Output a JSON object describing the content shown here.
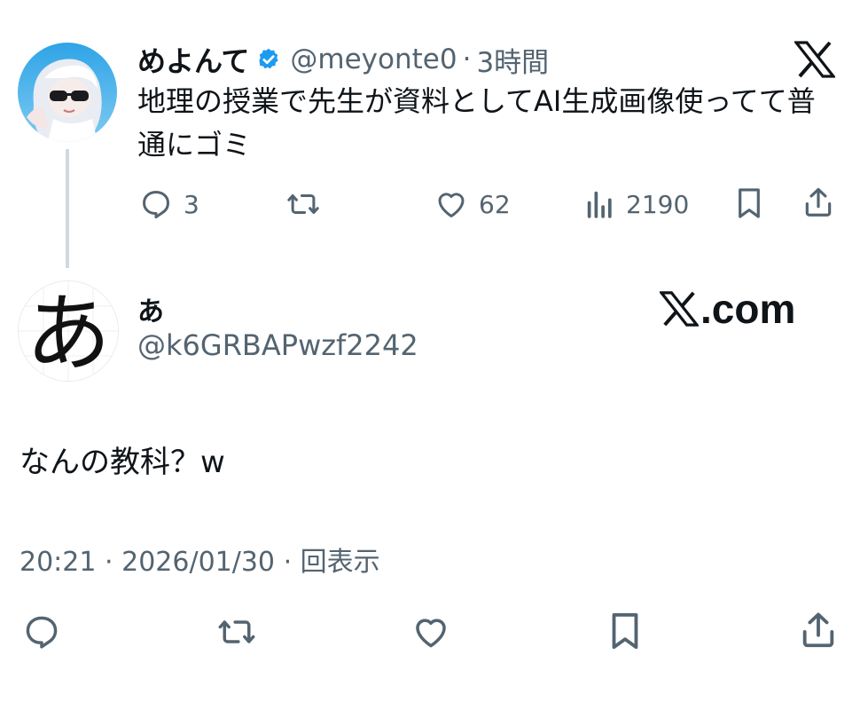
{
  "parent": {
    "display_name": "めよんて",
    "handle": "@meyonte0",
    "separator": "·",
    "time_ago": "3時間",
    "text": "地理の授業で先生が資料としてAI生成画像使ってて普通にゴミ",
    "reply_count": "3",
    "like_count": "62",
    "view_count": "2190"
  },
  "reply": {
    "display_name": "あ",
    "handle": "@k6GRBAPwzf2242",
    "avatar_glyph": "あ",
    "text": "なんの教科？w",
    "time": "20:21",
    "date": "2026/01/30",
    "separator": "·",
    "views_label": "回表示"
  },
  "brand": {
    "watermark_text": ".com"
  },
  "colors": {
    "verified": "#1d9bf0",
    "secondary_text": "#536471",
    "thread_line": "#cfd9de"
  },
  "icons": [
    "reply-icon",
    "retweet-icon",
    "like-icon",
    "views-icon",
    "bookmark-icon",
    "share-icon",
    "x-logo-icon",
    "verified-badge-icon"
  ]
}
